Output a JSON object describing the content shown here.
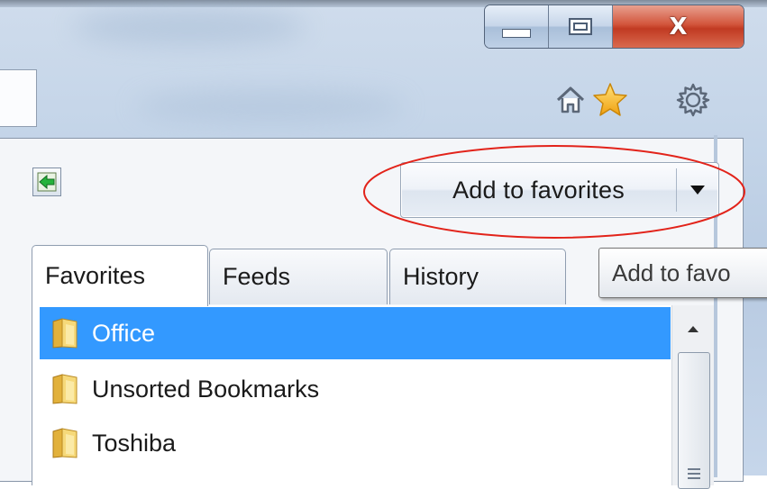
{
  "window": {
    "caption_buttons": [
      "minimize",
      "maximize",
      "close"
    ],
    "close_glyph": "X"
  },
  "toolbar": {
    "icons": [
      "home-icon",
      "star-icon",
      "gear-icon"
    ]
  },
  "favorites_center": {
    "pin_icon": "pin-favorites-center-icon",
    "add_button_label": "Add to favorites",
    "add_button_dropdown_icon": "chevron-down-icon",
    "tabs": [
      {
        "label": "Favorites",
        "selected": true
      },
      {
        "label": "Feeds",
        "selected": false
      },
      {
        "label": "History",
        "selected": false
      }
    ],
    "tooltip": "Add to favo",
    "items": [
      {
        "label": "Office",
        "icon": "folder-icon",
        "selected": true
      },
      {
        "label": "Unsorted Bookmarks",
        "icon": "folder-icon",
        "selected": false
      },
      {
        "label": "Toshiba",
        "icon": "folder-icon",
        "selected": false
      }
    ]
  },
  "colors": {
    "selection": "#3399ff",
    "highlight_ellipse": "#e2231a",
    "star": "#f5b31b",
    "close_button": "#c9462d"
  }
}
